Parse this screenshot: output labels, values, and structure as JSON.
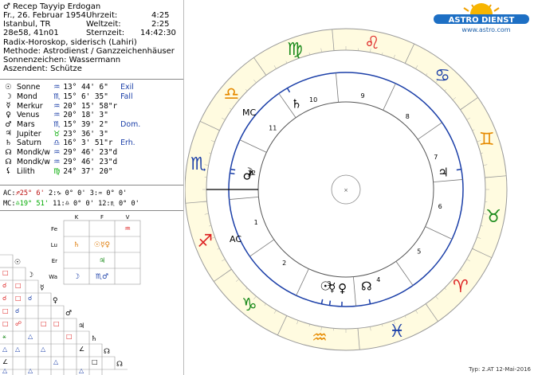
{
  "header": {
    "name": "Recep Tayyip Erdogan",
    "name_symbol": "♂",
    "date": "Fr., 26. Februar 1954",
    "place": "Istanbul, TR",
    "coords": "28e58, 41n01",
    "time_label": "Uhrzeit:",
    "time_value": "4:25",
    "worldtime_label": "Weltzeit:",
    "worldtime_value": "2:25",
    "sidereal_label": "Sternzeit:",
    "sidereal_value": "14:42:30",
    "line1": "Radix-Horoskop, siderisch (Lahiri)",
    "line2": "Methode: Astrodienst / Ganzzeichenhäuser",
    "line3": "Sonnenzeichen: Wassermann",
    "line4": "Aszendent: Schütze"
  },
  "logo": {
    "brand": "ASTRO DIENST",
    "url": "www.astro.com"
  },
  "planets": [
    {
      "glyph": "☉",
      "name": "Sonne",
      "sign": "♒",
      "pos": "13° 44'  6\"",
      "note": "Exil"
    },
    {
      "glyph": "☽",
      "name": "Mond",
      "sign": "♏",
      "pos": "15°  6' 35\"",
      "note": "Fall"
    },
    {
      "glyph": "☿",
      "name": "Merkur",
      "sign": "♒",
      "pos": "20° 15' 58\"r",
      "note": ""
    },
    {
      "glyph": "♀",
      "name": "Venus",
      "sign": "♒",
      "pos": "20° 18'  3\"",
      "note": ""
    },
    {
      "glyph": "♂",
      "name": "Mars",
      "sign": "♏",
      "pos": "15° 39'  2\"",
      "note": "Dom."
    },
    {
      "glyph": "♃",
      "name": "Jupiter",
      "sign": "♉",
      "pos": "23° 36'  3\"",
      "note": ""
    },
    {
      "glyph": "♄",
      "name": "Saturn",
      "sign": "♎",
      "pos": "16°  3' 51\"r",
      "note": "Erh."
    },
    {
      "glyph": "☊",
      "name": "Mondk/w",
      "sign": "♒",
      "pos": "29° 46' 23\"d",
      "note": ""
    },
    {
      "glyph": "☊",
      "name": "Mondk/w",
      "sign": "♒",
      "pos": "29° 46' 23\"d",
      "note": ""
    },
    {
      "glyph": "⚸",
      "name": "Lilith",
      "sign": "♍",
      "pos": "24° 37' 20\"",
      "note": ""
    }
  ],
  "houses": [
    {
      "label": "AC:",
      "value": "♐25°  6'",
      "h2": "2:",
      "v2": "♑ 0°  0'",
      "h3": "3:",
      "v3": "♒ 0°  0'"
    },
    {
      "label": "MC:",
      "value": "♎19° 51'",
      "h2": "11:",
      "v2": "♎ 0°  0'",
      "h3": "12:",
      "v3": "♏ 0°  0'"
    }
  ],
  "elements_table": {
    "cols": [
      "K",
      "F",
      "V"
    ],
    "rows": [
      "Fe",
      "Lu",
      "Er",
      "Wa"
    ]
  },
  "wheel": {
    "house_numbers": [
      "1",
      "2",
      "3",
      "4",
      "5",
      "6",
      "7",
      "8",
      "9",
      "10",
      "11",
      "12"
    ],
    "asc_label": "AC",
    "mc_label": "MC",
    "center_mark": "×"
  },
  "footer": "Typ: 2.AT   12-Mai-2016",
  "colors": {
    "fire": "#d22",
    "earth": "#1a8a1a",
    "air": "#e68a00",
    "water": "#1b3fa8"
  }
}
